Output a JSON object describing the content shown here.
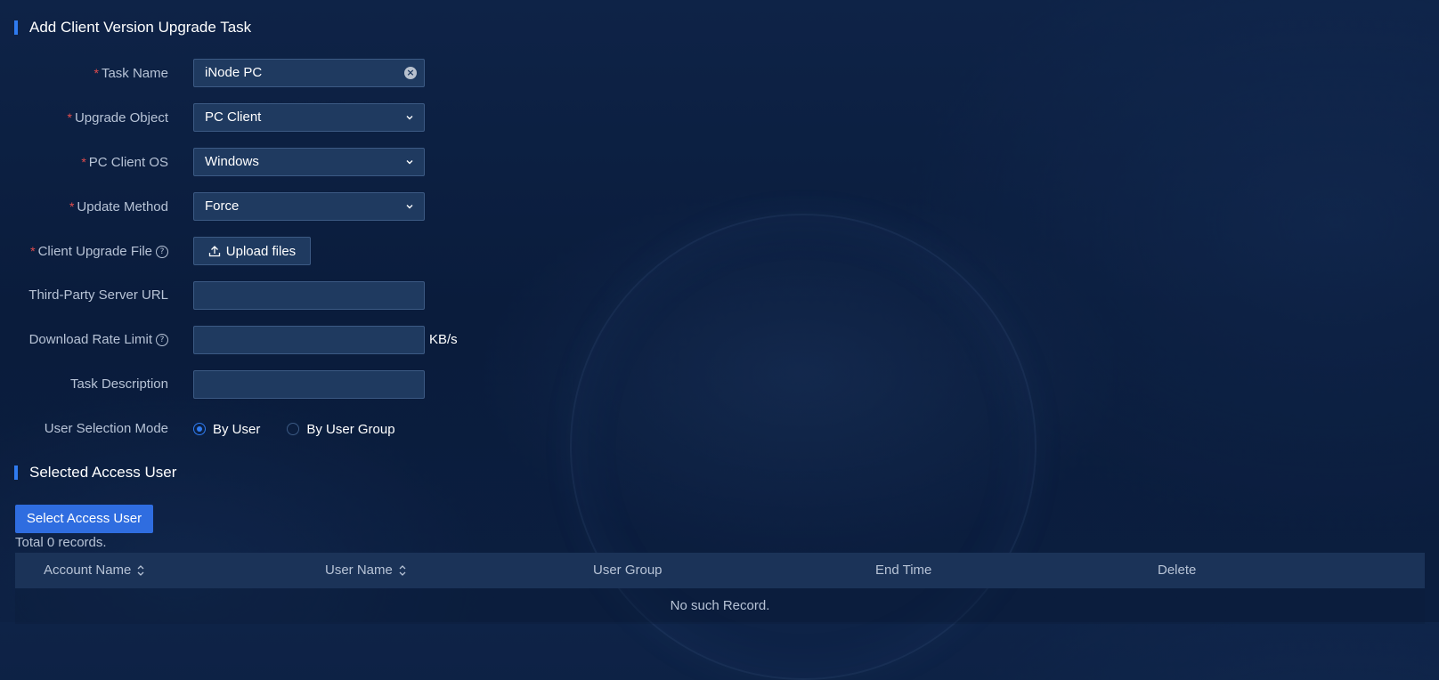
{
  "sections": {
    "add_task_title": "Add Client Version Upgrade Task",
    "selected_users_title": "Selected Access User"
  },
  "form": {
    "task_name": {
      "label": "Task Name",
      "required": true,
      "value": "iNode PC"
    },
    "upgrade_object": {
      "label": "Upgrade Object",
      "required": true,
      "value": "PC Client"
    },
    "pc_client_os": {
      "label": "PC Client OS",
      "required": true,
      "value": "Windows"
    },
    "update_method": {
      "label": "Update Method",
      "required": true,
      "value": "Force"
    },
    "client_upgrade_file": {
      "label": "Client Upgrade File",
      "required": true,
      "button_label": "Upload files"
    },
    "third_party_url": {
      "label": "Third-Party Server URL",
      "value": ""
    },
    "download_rate_limit": {
      "label": "Download Rate Limit",
      "value": "",
      "unit": "KB/s"
    },
    "task_description": {
      "label": "Task Description",
      "value": ""
    },
    "user_selection_mode": {
      "label": "User Selection Mode",
      "options": [
        "By User",
        "By User Group"
      ],
      "selected": "By User"
    }
  },
  "required_mark": "*",
  "help_glyph": "?",
  "clear_glyph": "×",
  "select_button_label": "Select Access User",
  "total_text": "Total 0 records.",
  "table": {
    "columns": [
      "Account Name",
      "User Name",
      "User Group",
      "End Time",
      "Delete"
    ],
    "empty_text": "No such Record."
  },
  "colors": {
    "accent": "#2f7bf0",
    "primary_button": "#2f6de0",
    "required": "#e34d4d",
    "background": "#0b1e3f"
  }
}
